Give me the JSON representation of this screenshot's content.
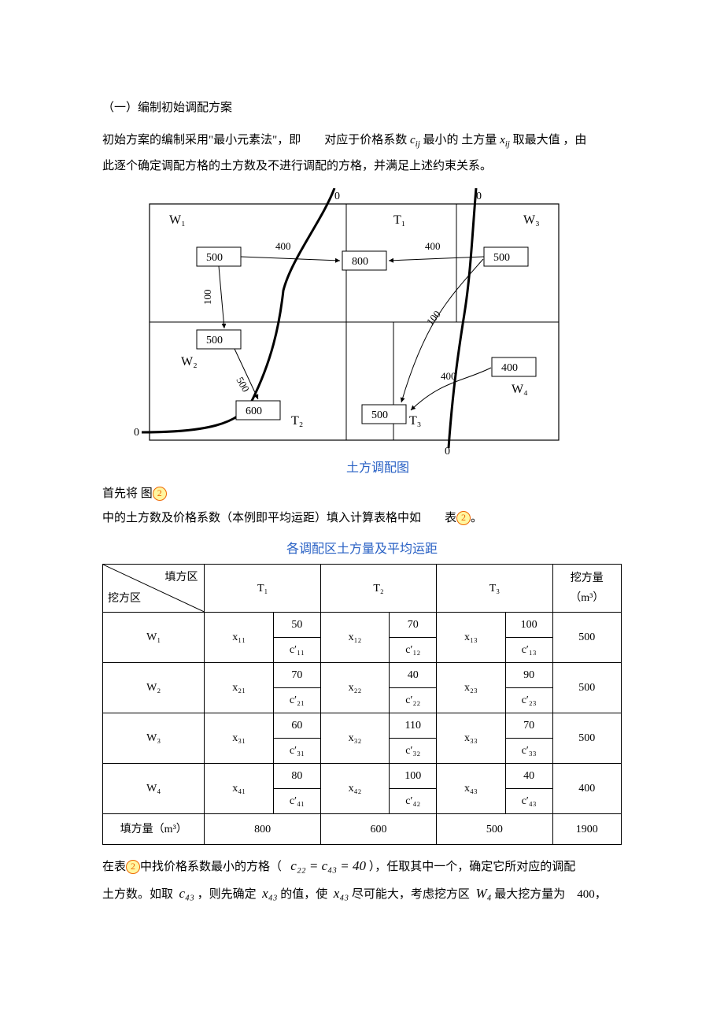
{
  "heading": "（一）编制初始调配方案",
  "p1_a": "初始方案的编制采用\"最小元素法\"，即　　对应于价格系数",
  "p1_c1": "c",
  "p1_c1_sub": "ij",
  "p1_b": "最小的 土方量",
  "p1_x1": "x",
  "p1_x1_sub": "ij",
  "p1_c": "取最大值 ，由",
  "p1_d": "此逐个确定调配方格的土方数及不进行调配的方格，并满足上述约束关系。",
  "fig": {
    "caption": "土方调配图",
    "labels": {
      "W1": "W₁",
      "W2": "W₂",
      "W3": "W₃",
      "W4": "W₄",
      "T1": "T₁",
      "T2": "T₂",
      "T3": "T₃",
      "b500a": "500",
      "b500b": "500",
      "b500c": "500",
      "b500d": "500",
      "b800": "800",
      "b600": "600",
      "b400": "400",
      "e400a": "400",
      "e400b": "400",
      "e400c": "400",
      "e100a": "100",
      "e100b": "100",
      "e500": "500",
      "z0a": "0",
      "z0b": "0",
      "z0c": "0",
      "z0d": "0"
    }
  },
  "p2_a": "首先将 图",
  "p2_badge": "2",
  "p3_a": "中的土方数及价格系数（本例即平均运距）填入计算表格中如",
  "p3_b": "表",
  "p3_badge": "2",
  "p3_c": "。",
  "table_caption": "各调配区土方量及平均运距",
  "table": {
    "hdr_fill": "填方区",
    "hdr_cut": "挖方区",
    "T1": "T₁",
    "T2": "T₂",
    "T3": "T₃",
    "cut_vol_hdr_a": "挖方量",
    "cut_vol_hdr_b": "（m³）",
    "rows": [
      {
        "name": "W₁",
        "x": [
          "x₁₁",
          "x₁₂",
          "x₁₃"
        ],
        "c": [
          "c′₁₁",
          "c′₁₂",
          "c′₁₃"
        ],
        "v": [
          "50",
          "70",
          "100"
        ],
        "vol": "500"
      },
      {
        "name": "W₂",
        "x": [
          "x₂₁",
          "x₂₂",
          "x₂₃"
        ],
        "c": [
          "c′₂₁",
          "c′₂₂",
          "c′₂₃"
        ],
        "v": [
          "70",
          "40",
          "90"
        ],
        "vol": "500"
      },
      {
        "name": "W₃",
        "x": [
          "x₃₁",
          "x₃₂",
          "x₃₃"
        ],
        "c": [
          "c′₃₁",
          "c′₃₂",
          "c′₃₃"
        ],
        "v": [
          "60",
          "110",
          "70"
        ],
        "vol": "500"
      },
      {
        "name": "W₄",
        "x": [
          "x₄₁",
          "x₄₂",
          "x₄₃"
        ],
        "c": [
          "c′₄₁",
          "c′₄₂",
          "c′₄₃"
        ],
        "v": [
          "80",
          "100",
          "40"
        ],
        "vol": "400"
      }
    ],
    "foot_label": "填方量（m³）",
    "foot": [
      "800",
      "600",
      "500",
      "1900"
    ]
  },
  "p4_a": "在表",
  "p4_badge": "2",
  "p4_b": "中找价格系数最小的方格（",
  "p4_eq_a": "c₂₂ = c₄₃ = 40",
  "p4_c": "），任取其中一个，确定它所对应的调配",
  "p5_a": "土方数。如取",
  "p5_c43": "c₄₃",
  "p5_b": "，则先确定",
  "p5_x43a": "x₄₃",
  "p5_c": "的值，使",
  "p5_x43b": "x₄₃",
  "p5_d": "尽可能大，考虑挖方区",
  "p5_w4": "W₄",
  "p5_e": "最大挖方量为　400，"
}
